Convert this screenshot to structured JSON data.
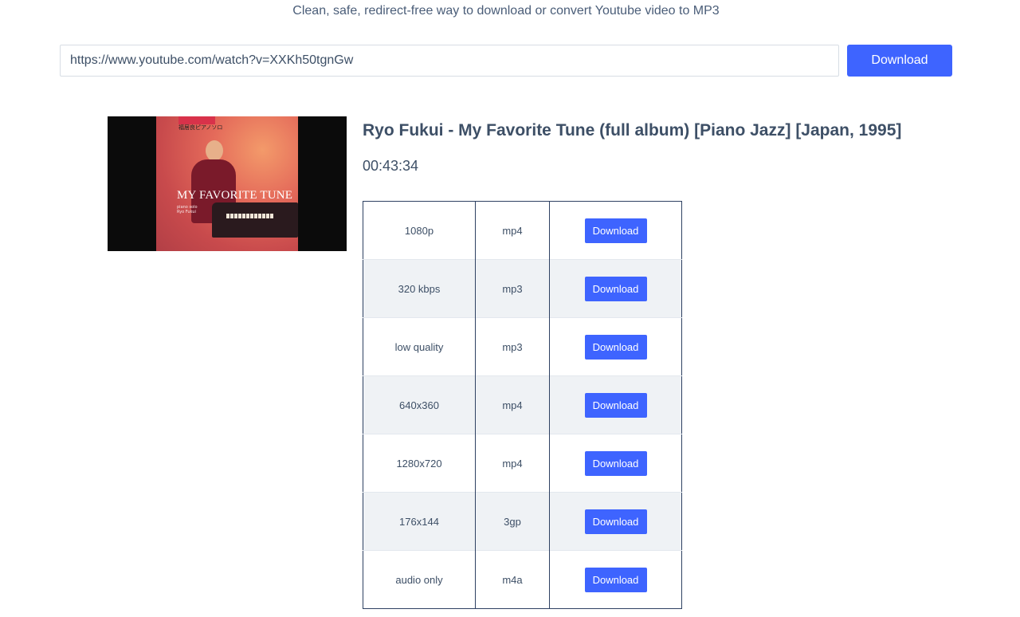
{
  "tagline": "Clean, safe, redirect-free way to download or convert Youtube video to MP3",
  "search": {
    "url_value": "https://www.youtube.com/watch?v=XXKh50tgnGw",
    "button_label": "Download"
  },
  "video": {
    "title": "Ryo Fukui - My Favorite Tune (full album) [Piano Jazz] [Japan, 1995]",
    "duration": "00:43:34",
    "thumbnail": {
      "album_title": "MY FAVORITE TUNE",
      "japanese_text": "福居良ピアノソロ",
      "subtitle_line1": "piano solo",
      "subtitle_line2": "Ryo Fukui"
    }
  },
  "formats": [
    {
      "quality": "1080p",
      "format": "mp4",
      "action": "Download"
    },
    {
      "quality": "320 kbps",
      "format": "mp3",
      "action": "Download"
    },
    {
      "quality": "low quality",
      "format": "mp3",
      "action": "Download"
    },
    {
      "quality": "640x360",
      "format": "mp4",
      "action": "Download"
    },
    {
      "quality": "1280x720",
      "format": "mp4",
      "action": "Download"
    },
    {
      "quality": "176x144",
      "format": "3gp",
      "action": "Download"
    },
    {
      "quality": "audio only",
      "format": "m4a",
      "action": "Download"
    }
  ],
  "colors": {
    "accent": "#3e64ff",
    "text": "#3d4f66",
    "row_alt": "#eff2f5",
    "table_border": "#2e4162"
  }
}
